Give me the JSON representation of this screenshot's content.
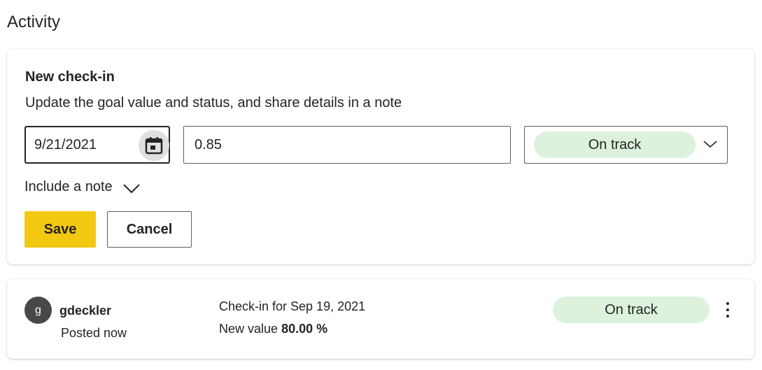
{
  "page": {
    "title": "Activity"
  },
  "checkin": {
    "title": "New check-in",
    "description": "Update the goal value and status, and share details in a note",
    "date_value": "9/21/2021",
    "goal_value": "0.85",
    "status": "On track",
    "note_toggle_label": "Include a note",
    "save_label": "Save",
    "cancel_label": "Cancel"
  },
  "activity": {
    "avatar_initial": "g",
    "user": "gdeckler",
    "posted": "Posted now",
    "checkin_date": "Check-in for Sep 19, 2021",
    "new_value_label": "New value",
    "new_value": "80.00 %",
    "status": "On track"
  },
  "colors": {
    "accent": "#f2c811",
    "status_on_track_bg": "#dcf2dc",
    "avatar_bg": "#4a4847"
  },
  "icons": {
    "calendar": "calendar-icon",
    "status_dropdown": "chevron-down-icon",
    "note_toggle": "chevron-down-icon",
    "more": "more-vertical-icon"
  }
}
